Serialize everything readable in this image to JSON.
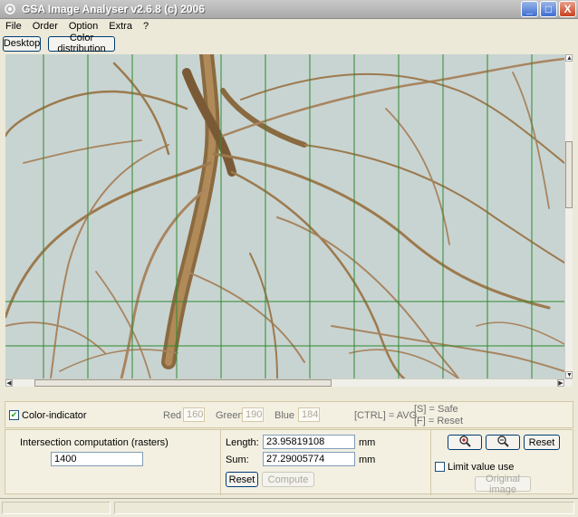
{
  "window": {
    "title": "GSA Image Analyser v2.6.8 (c) 2006",
    "minimize_label": "_",
    "maximize_label": "□",
    "close_label": "X"
  },
  "menu": [
    "File",
    "Order",
    "Option",
    "Extra",
    "?"
  ],
  "toolbar": {
    "desktop_label": "Desktop",
    "color_distribution_label": "Color distribution"
  },
  "color_panel": {
    "indicator_label": "Color-indicator",
    "indicator_checked": true,
    "red_label": "Red",
    "red_value": "160",
    "green_label": "Green",
    "green_value": "190",
    "blue_label": "Blue",
    "blue_value": "184",
    "ctrl_hint": "[CTRL] = AVG",
    "save_hint": "[S] = Safe",
    "reset_hint": "[F] = Reset"
  },
  "intersection": {
    "title": "Intersection computation (rasters)",
    "value": "1400"
  },
  "measure": {
    "length_label": "Length:",
    "length_value": "23.95819108",
    "length_unit": "mm",
    "sum_label": "Sum:",
    "sum_value": "27.29005774",
    "sum_unit": "mm",
    "reset_label": "Reset",
    "compute_label": "Compute"
  },
  "view": {
    "zoom_in_icon": "zoom-in-icon",
    "zoom_out_icon": "zoom-out-icon",
    "reset_label": "Reset",
    "limit_label": "Limit value use",
    "limit_checked": false,
    "original_image_label": "Original image"
  },
  "colors": {
    "grid_line": "#2f8a2f",
    "image_background": "#c8d4d2",
    "root": "#9c7a4e",
    "root_dark": "#6f5232",
    "window_face": "#ece9d8",
    "panel_face": "#f3f0e2"
  },
  "icons": {
    "app": "app-logo-icon",
    "checkmark": "checkmark-icon",
    "arrow_up": "arrow-up-icon",
    "arrow_down": "arrow-down-icon",
    "arrow_left": "arrow-left-icon",
    "arrow_right": "arrow-right-icon"
  }
}
